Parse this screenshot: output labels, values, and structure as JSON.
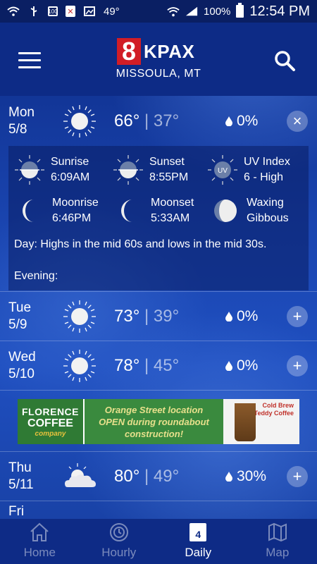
{
  "status_bar": {
    "battery_label": "100",
    "temp": "49°",
    "battery_pct": "100%",
    "time": "12:54 PM"
  },
  "header": {
    "logo_number": "8",
    "logo_text": "KPAX",
    "location": "MISSOULA, MT"
  },
  "days": [
    {
      "day": "Mon",
      "date": "5/8",
      "high": "66°",
      "low": "37°",
      "sep": "|",
      "precip": "0%",
      "icon": "sun-icon",
      "toggle": "×"
    },
    {
      "day": "Tue",
      "date": "5/9",
      "high": "73°",
      "low": "39°",
      "sep": "|",
      "precip": "0%",
      "icon": "sun-icon",
      "toggle": "+"
    },
    {
      "day": "Wed",
      "date": "5/10",
      "high": "78°",
      "low": "45°",
      "sep": "|",
      "precip": "0%",
      "icon": "sun-icon",
      "toggle": "+"
    },
    {
      "day": "Thu",
      "date": "5/11",
      "high": "80°",
      "low": "49°",
      "sep": "|",
      "precip": "30%",
      "icon": "partly-cloudy-icon",
      "toggle": "+"
    },
    {
      "day": "Fri",
      "date": "",
      "icon": "partly-cloudy-icon"
    }
  ],
  "details": {
    "sunrise_label": "Sunrise",
    "sunrise_time": "6:09AM",
    "sunset_label": "Sunset",
    "sunset_time": "8:55PM",
    "uv_label": "UV Index",
    "uv_value": "6 - High",
    "uv_badge": "UV",
    "moonrise_label": "Moonrise",
    "moonrise_time": "6:46PM",
    "moonset_label": "Moonset",
    "moonset_time": "5:33AM",
    "phase_line1": "Waxing",
    "phase_line2": "Gibbous",
    "day_text": "Day: Highs in the mid 60s and lows in the mid 30s.",
    "evening_text": "Evening:"
  },
  "ad": {
    "brand1": "FLORENCE",
    "brand2": "COFFEE",
    "brand3": "company",
    "line1": "Orange Street location",
    "line2": "OPEN during roundabout",
    "line3": "construction!",
    "right1": "Cold Brew",
    "right2": "Teddy Coffee"
  },
  "nav": {
    "home": "Home",
    "hourly": "Hourly",
    "daily": "Daily",
    "daily_day": "4",
    "map": "Map"
  }
}
